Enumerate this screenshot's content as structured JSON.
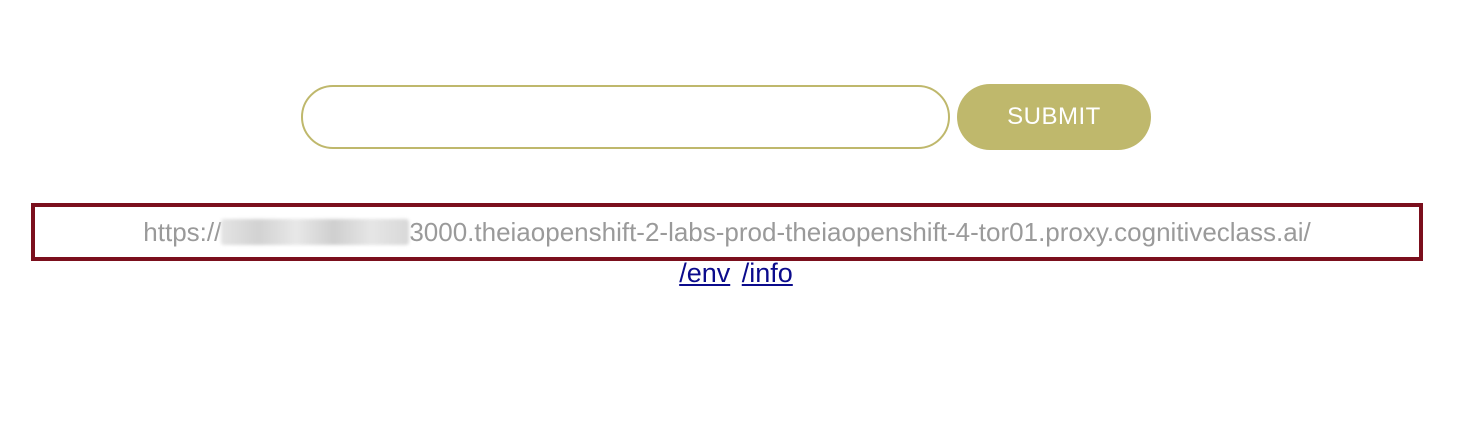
{
  "form": {
    "input_value": "",
    "input_placeholder": "",
    "submit_label": "SUBMIT"
  },
  "url_display": {
    "prefix": "https://",
    "suffix": "3000.theiaopenshift-2-labs-prod-theiaopenshift-4-tor01.proxy.cognitiveclass.ai/"
  },
  "links": [
    {
      "label": "/env"
    },
    {
      "label": "/info"
    }
  ],
  "colors": {
    "accent": "#bfb86c",
    "highlight_border": "#7b0f1d",
    "url_text": "#9a9a9a",
    "link": "#0b0b8c"
  }
}
